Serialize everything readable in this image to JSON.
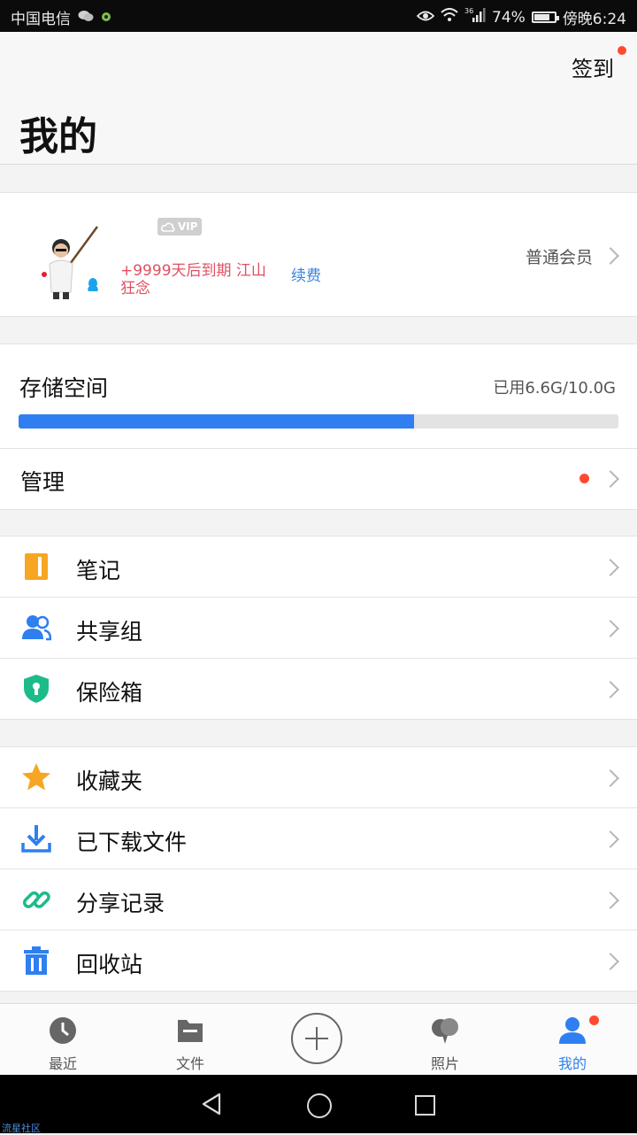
{
  "status_bar": {
    "carrier": "中国电信",
    "battery_percent": "74%",
    "time": "傍晚6:24",
    "network_label": "36",
    "icons": [
      "wechat-icon",
      "app-icon",
      "eye-icon",
      "wifi-icon",
      "signal-icon",
      "battery-icon"
    ]
  },
  "header": {
    "title": "我的",
    "signin_label": "签到"
  },
  "profile": {
    "vip_label": "VIP",
    "expiry_text": "+9999天后到期 江山狂念",
    "renew_label": "续费",
    "member_label": "普通会员"
  },
  "storage": {
    "title": "存储空间",
    "used_text": "已用6.6G/10.0G",
    "used_gb": 6.6,
    "total_gb": 10.0,
    "manage_label": "管理"
  },
  "groups": [
    {
      "items": [
        {
          "label": "笔记",
          "icon": "notebook-icon",
          "color": "#f6a623"
        },
        {
          "label": "共享组",
          "icon": "group-users-icon",
          "color": "#2f7ff0"
        },
        {
          "label": "保险箱",
          "icon": "shield-lock-icon",
          "color": "#1dbb8a"
        }
      ]
    },
    {
      "items": [
        {
          "label": "收藏夹",
          "icon": "star-icon",
          "color": "#f6a623"
        },
        {
          "label": "已下载文件",
          "icon": "download-icon",
          "color": "#2f7ff0"
        },
        {
          "label": "分享记录",
          "icon": "link-icon",
          "color": "#1dbb8a"
        },
        {
          "label": "回收站",
          "icon": "trash-icon",
          "color": "#2f7ff0"
        }
      ]
    }
  ],
  "bottom_nav": {
    "recent": "最近",
    "files": "文件",
    "photos": "照片",
    "mine": "我的"
  },
  "watermark": "流星社区",
  "colors": {
    "accent": "#2f7ff0",
    "alert_dot": "#ff4a2f",
    "expiry_text": "#e04f62"
  }
}
